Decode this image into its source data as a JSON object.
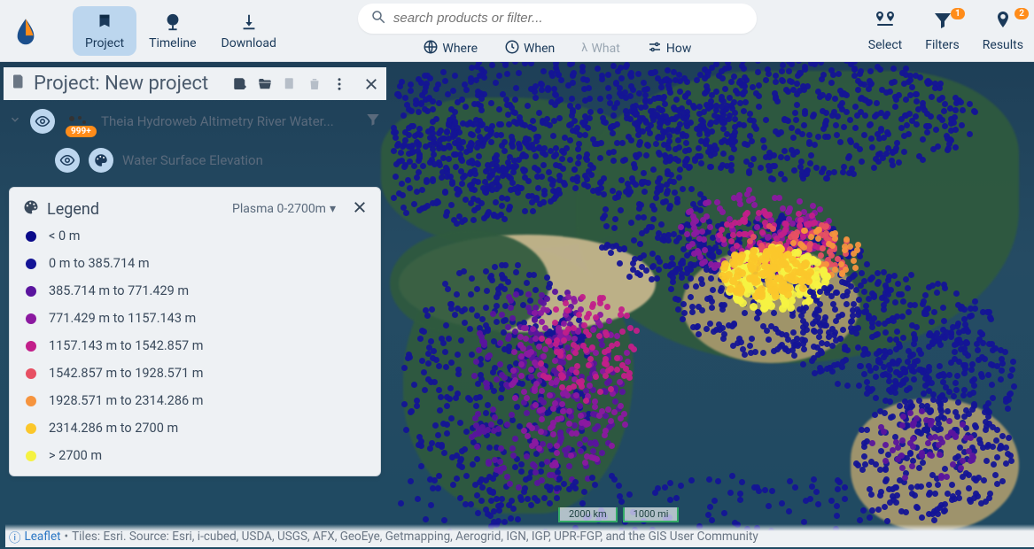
{
  "nav": {
    "tabs": [
      {
        "key": "project",
        "label": "Project",
        "active": true
      },
      {
        "key": "timeline",
        "label": "Timeline",
        "active": false
      },
      {
        "key": "download",
        "label": "Download",
        "active": false
      }
    ]
  },
  "search": {
    "placeholder": "search products or filter..."
  },
  "subnav": {
    "where": "Where",
    "when": "When",
    "what": "What",
    "how": "How"
  },
  "tools": {
    "select": {
      "label": "Select"
    },
    "filters": {
      "label": "Filters",
      "badge": "1"
    },
    "results": {
      "label": "Results",
      "badge": "2"
    }
  },
  "project": {
    "title": "Project: New project",
    "layer": {
      "name": "Theia Hydroweb Altimetry River Water...",
      "count_badge": "999+",
      "sublayer": "Water Surface Elevation"
    }
  },
  "legend": {
    "title": "Legend",
    "scheme": "Plasma 0-2700m",
    "items": [
      {
        "color": "#0a0a8a",
        "label": "< 0 m"
      },
      {
        "color": "#141496",
        "label": "0 m to 385.714 m"
      },
      {
        "color": "#5a149e",
        "label": "385.714 m to 771.429 m"
      },
      {
        "color": "#8b19a0",
        "label": "771.429 m to 1157.143 m"
      },
      {
        "color": "#c21f8a",
        "label": "1157.143 m to 1542.857 m"
      },
      {
        "color": "#e75063",
        "label": "1542.857 m to 1928.571 m"
      },
      {
        "color": "#f6943e",
        "label": "1928.571 m to 2314.286 m"
      },
      {
        "color": "#fbc72b",
        "label": "2314.286 m to 2700 m"
      },
      {
        "color": "#f5f242",
        "label": "> 2700 m"
      }
    ]
  },
  "scale": {
    "km": "2000 km",
    "mi": "1000 mi"
  },
  "attribution": {
    "leaflet": "Leaflet",
    "sep": " • ",
    "text": "Tiles: Esri. Source: Esri, i-cubed, USDA, USGS, AFX, GeoEye, Getmapping, Aerogrid, IGN, IGP, UPR-FGP, and the GIS User Community"
  },
  "chart_data": {
    "type": "map-choropleth-points",
    "variable": "Water Surface Elevation",
    "unit": "m",
    "color_scale": "Plasma",
    "domain": [
      0,
      2700
    ],
    "bins": [
      {
        "min": null,
        "max": 0,
        "color": "#0a0a8a"
      },
      {
        "min": 0,
        "max": 385.714,
        "color": "#141496"
      },
      {
        "min": 385.714,
        "max": 771.429,
        "color": "#5a149e"
      },
      {
        "min": 771.429,
        "max": 1157.143,
        "color": "#8b19a0"
      },
      {
        "min": 1157.143,
        "max": 1542.857,
        "color": "#c21f8a"
      },
      {
        "min": 1542.857,
        "max": 1928.571,
        "color": "#e75063"
      },
      {
        "min": 1928.571,
        "max": 2314.286,
        "color": "#f6943e"
      },
      {
        "min": 2314.286,
        "max": 2700,
        "color": "#fbc72b"
      },
      {
        "min": 2700,
        "max": null,
        "color": "#f5f242"
      }
    ],
    "notes": "World map of altimetry river-gauge virtual stations. Dense low-elevation (dark blue) points across Europe, Siberian rivers, West/Central Africa, SE Asia, Amazon fringe; magenta/orange mid-elevation across East Africa and Central Asia; bright yellow >2700 m cluster over Tibetan Plateau / Himalaya region."
  }
}
